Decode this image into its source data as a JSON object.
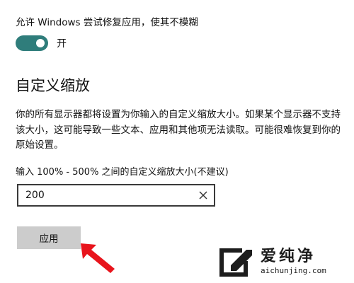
{
  "fix_apps": {
    "label": "允许 Windows 尝试修复应用，使其不模糊",
    "toggle_state": "开",
    "toggle_on": true
  },
  "custom_scaling": {
    "title": "自定义缩放",
    "description": "你的所有显示器都将设置为你输入的自定义缩放大小。如果某个显示器不支持该大小，这可能导致一些文本、应用和其他项无法读取。可能很难恢复到你的原始设置。",
    "range_label": "输入 100% - 500% 之间的自定义缩放大小(不建议)",
    "input_value": "200",
    "apply_label": "应用"
  },
  "watermark": {
    "cn": "爱纯净",
    "en": "aichunjing.com"
  },
  "colors": {
    "accent": "#2f7d7b",
    "button_bg": "#cccccc",
    "arrow": "#e8141c"
  },
  "icons": {
    "clear": "close-icon",
    "pointer": "red-arrow-icon",
    "logo": "aichunjing-logo-icon"
  }
}
